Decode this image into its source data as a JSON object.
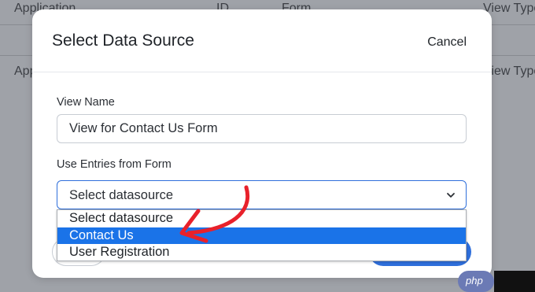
{
  "background_table": {
    "headers": [
      "Application",
      "ID",
      "Form",
      "View Type"
    ],
    "row_cells": [
      "Application",
      "View Type"
    ]
  },
  "modal": {
    "title": "Select Data Source",
    "cancel_label": "Cancel",
    "view_name": {
      "label": "View Name",
      "value": "View for Contact Us Form"
    },
    "entries_form": {
      "label": "Use Entries from Form",
      "selected_value": "Select datasource",
      "options": [
        "Select datasource",
        "Contact Us",
        "User Registration"
      ],
      "highlighted_option": "Contact Us"
    }
  },
  "colors": {
    "accent": "#2f6fdb",
    "option_highlight": "#1a73e8",
    "annotation_arrow": "#e8212b"
  },
  "icons": {
    "select_chevron": "chevron-down-icon",
    "annotation": "red-arrow-annotation"
  },
  "watermark": "php"
}
